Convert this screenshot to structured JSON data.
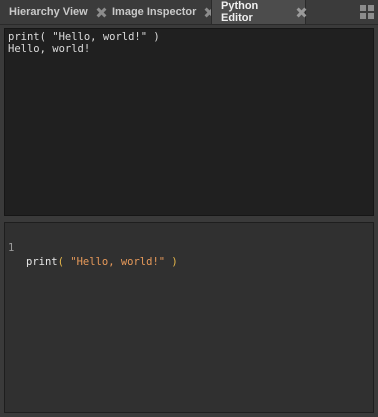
{
  "tabs": [
    {
      "label": "Hierarchy View",
      "active": false
    },
    {
      "label": "Image Inspector",
      "active": false
    },
    {
      "label": "Python Editor",
      "active": true
    }
  ],
  "layout_menu_icon": "grid-icon",
  "output": {
    "lines": [
      "print( \"Hello, world!\" )",
      "Hello, world!"
    ]
  },
  "editor": {
    "line_number": "1",
    "code": {
      "func": "print",
      "open_paren": "(",
      "string": "\"Hello, world!\"",
      "close_paren": ")"
    }
  },
  "colors": {
    "paren": "#e8b84a",
    "string": "#e89a5a",
    "output_bg": "#202020",
    "editor_bg": "#303030"
  }
}
